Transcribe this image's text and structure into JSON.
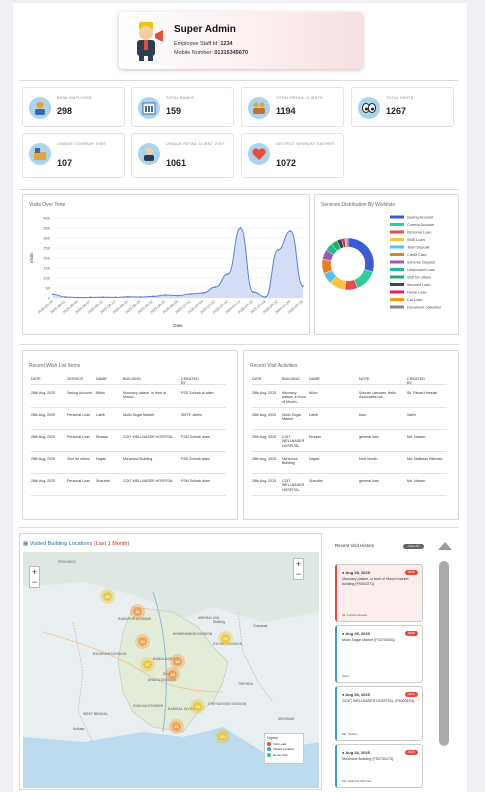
{
  "profile": {
    "name": "Super Admin",
    "staff_id_label": "Employee Staff Id:",
    "staff_id": "1234",
    "mobile_label": "Mobile Number:",
    "mobile": "01315345670"
  },
  "stats": [
    {
      "label": "BANK EMPLOYEE",
      "value": "298",
      "icon": "person-icon"
    },
    {
      "label": "TOTAL BANKS",
      "value": "159",
      "icon": "bank-icon"
    },
    {
      "label": "TOTAL RETAIL CLIENTS",
      "value": "1194",
      "icon": "group-icon"
    },
    {
      "label": "TOTAL VISITS",
      "value": "1267",
      "icon": "eyes-icon"
    },
    {
      "label": "UNIQUE COMPANY VISIT",
      "value": "107",
      "icon": "company-icon"
    },
    {
      "label": "UNIQUE RETAIL CLIENT VISIT",
      "value": "1061",
      "icon": "client-icon"
    },
    {
      "label": "DISTRICT WISHLIST ENTRIES",
      "value": "1072",
      "icon": "heart-icon"
    }
  ],
  "visits_chart": {
    "title": "Visits Over Time",
    "ylabel": "Visits",
    "xlabel": "Date",
    "colors": {
      "line": "#5b7fd6",
      "fill": "#c9d6f5"
    },
    "chart_data": {
      "type": "area",
      "x": [
        "2025-05-28",
        "2025-06-01",
        "2025-06-04",
        "2025-06-07",
        "2025-06-10",
        "2025-06-13",
        "2025-06-16",
        "2025-06-19",
        "2025-06-22",
        "2025-06-25",
        "2025-06-28",
        "2025-07-01",
        "2025-07-04",
        "2025-07-07",
        "2025-07-10",
        "2025-07-13",
        "2025-07-16",
        "2025-07-19",
        "2025-07-22",
        "2025-07-25",
        "2025-07-28"
      ],
      "values": [
        18,
        5,
        2,
        3,
        4,
        3,
        6,
        5,
        8,
        15,
        12,
        20,
        25,
        55,
        120,
        350,
        30,
        5,
        240,
        335,
        60
      ],
      "ylim": [
        0,
        400
      ],
      "yticks": [
        "400",
        "350",
        "300",
        "250",
        "200",
        "150",
        "100",
        "50",
        "0"
      ]
    }
  },
  "donut_chart": {
    "title": "Services Distribution By Wishlists",
    "chart_data": {
      "type": "pie",
      "categories": [
        "Saving Account",
        "Current Account",
        "Personal Loan",
        "SME Loan",
        "Term Deposit",
        "Credit Card",
        "Scheme Deposit",
        "Unsecured Loan",
        "Visit for others",
        "Secured Loan",
        "Home Loan",
        "Car Loan",
        "Document collection"
      ],
      "values": [
        30,
        14,
        8,
        10,
        7,
        9,
        6,
        5,
        4,
        3,
        2,
        1,
        1
      ],
      "colors": [
        "#3b5bd6",
        "#2ecc9a",
        "#e84c4c",
        "#f5c542",
        "#5bc0eb",
        "#e67e22",
        "#9b59b6",
        "#1abc9c",
        "#27ae60",
        "#34495e",
        "#e91e63",
        "#f39c12",
        "#7f8c8d"
      ]
    }
  },
  "wishlist": {
    "title": "Recent Wish List Items",
    "headers": [
      "DATE",
      "SERVICE",
      "NAME",
      "BUILDING",
      "CREATED BY"
    ],
    "rows": [
      [
        "28th Aug, 2025",
        "Saving Account",
        "Milon",
        "Moonacy palace, in front of Moulvi...",
        "FSD Sohrab-al alam"
      ],
      [
        "28th Aug, 2025",
        "Personal Loan",
        "Labib",
        "Mullo Sugar Market",
        "SMTE Jahim"
      ],
      [
        "28th Aug, 2025",
        "Personal Loan",
        "Ehsaan",
        "COIT WELLNASER HOSPITAL",
        "FSM Sohrab alam"
      ],
      [
        "28th Aug, 2025",
        "Visit for others",
        "Nayan",
        "Ma'amool Building",
        "FSD Sohrab alam"
      ],
      [
        "28th Aug, 2025",
        "Personal Loan",
        "Sharafat",
        "COIT WELLNASER HOSPITAL",
        "FSM Sohrab alam"
      ]
    ]
  },
  "visits_table": {
    "title": "Recent Visit Activities",
    "headers": [
      "DATE",
      "BUILDING",
      "NAME",
      "NOTE",
      "CREATED BY"
    ],
    "rows": [
      [
        "28th Aug, 2025",
        "Moonacy palace, in front of Moulvi...",
        "Milon",
        "Sohrab Laburam, Hello Associates Ltd...",
        "Sk. Fahad Hossain"
      ],
      [
        "28th Aug, 2025",
        "Mullo Sugar Market",
        "Labib",
        "karo",
        "Salim"
      ],
      [
        "28th Aug, 2025",
        "COIT WELLNASER HOSPITAL",
        "Ehsaan",
        "general loan",
        "Md. Nazam"
      ],
      [
        "28th Aug, 2025",
        "Ma'amool Building",
        "Nayan",
        "Next Month",
        "Md. Nafiswar Rahman"
      ],
      [
        "28th Aug, 2025",
        "COIT WELLNASER HOSPITAL",
        "Sharafat",
        "general loan",
        "Md. Nazam"
      ]
    ]
  },
  "map": {
    "title": "Visited Building Locations",
    "subtitle": "(Last 1 Month)",
    "clusters": [
      "15",
      "11",
      "10",
      "17",
      "18",
      "10",
      "20",
      "13",
      "21",
      "10"
    ],
    "labels": [
      "PROVINCE",
      "RANGPUR DIVISION",
      "SYLHET DIVISION",
      "MYMENSINGH DIVISION",
      "BANGLADESH",
      "MEGHALAYA",
      "DHAKA DIVISION",
      "RAJSHAHI DIVISION",
      "KHULNA DIVISION",
      "BARISAL DIVISION",
      "CHITTAGONG DIVISION",
      "WEST BENGAL",
      "TRIPURA",
      "MIZORAM",
      "Guwahati",
      "Shillong",
      "Dhaka",
      "Kolkata"
    ],
    "legend": [
      "Visit Lead",
      "Visited Location",
      "Home Visit"
    ]
  },
  "visit_history": {
    "title": "Recent Visit History",
    "button": "View All",
    "cards": [
      {
        "date": "Aug 28, 2025",
        "tag": "NEW",
        "text": "Moonacy palace, in front of Moulvi market building (FS002271)",
        "meta": "Sk. Fahad Hossain"
      },
      {
        "date": "Aug 28, 2025",
        "tag": "NEW",
        "text": "Mullo Sugar Market (FS0730001)",
        "meta": "Salim"
      },
      {
        "date": "Aug 28, 2025",
        "tag": "NEW",
        "text": "GOVT WELLNASER HOSPITAL (FS0034S4)",
        "meta": "Md. Nazam"
      },
      {
        "date": "Aug 28, 2025",
        "tag": "NEW",
        "text": "Ma'amool Building (FS0730173)",
        "meta": "Md. Nafiswar Rahman"
      }
    ]
  }
}
